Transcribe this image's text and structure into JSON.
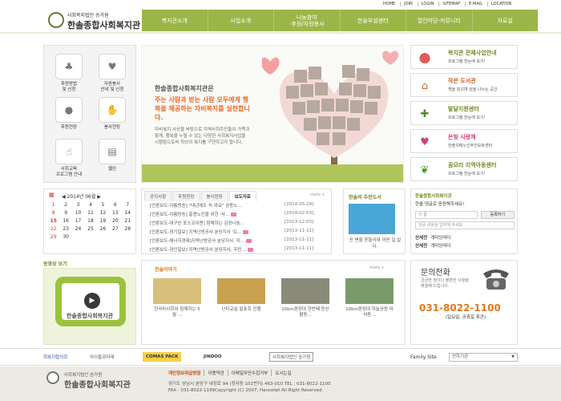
{
  "util_links": [
    "HOME",
    "JOIN",
    "LOGIN",
    "SITEMAP",
    "E-MAIL",
    "LOCATION"
  ],
  "logo": {
    "sub": "사회복지법인 승가원",
    "main": "한솔종합사회복지관"
  },
  "gnb": [
    {
      "label": "복지관소개"
    },
    {
      "label": "사업소개"
    },
    {
      "label": "나눔참여\n-후원/자원봉사"
    },
    {
      "label": "한솔부설센터"
    },
    {
      "label": "열린마당-커뮤니티"
    },
    {
      "label": "자료실"
    }
  ],
  "quick_menu": [
    {
      "label": "후원방법\n및 신청",
      "icon": "piggy-icon"
    },
    {
      "label": "자원봉사\n안내 및 신청",
      "icon": "heart-icon"
    },
    {
      "label": "후원현장",
      "icon": "gift-icon"
    },
    {
      "label": "봉사현장",
      "icon": "hands-icon"
    },
    {
      "label": "사회교육\n프로그램 안내",
      "icon": "pointer-icon"
    },
    {
      "label": "웹진",
      "icon": "book-icon"
    }
  ],
  "visual": {
    "title": "한솔종합사회복지관은",
    "slogan": "주는 사람과 받는 사람 모두에게 행복을 제공하는 자비복지를 실천합니다.",
    "desc": "자비복지 사상을 바탕으로 지역사회주민들이 가족과 함께, 행복을 누릴 수 있는 다양한 사회복지사업을 시행함으로써 최상의 복지를 구현하고자 합니다."
  },
  "right_banners": [
    {
      "title": "복지관 전체사업안내",
      "sub": "프로그램 한눈에 보기!",
      "icon": "balloon-icon"
    },
    {
      "title": "작은 도서관",
      "sub": "책을 읽으며 성을 나누는 공간.",
      "icon": "house-icon"
    },
    {
      "title": "발달지원센터",
      "sub": "프로그램 한눈에 보기!",
      "icon": "puzzle-icon"
    },
    {
      "title": "은빛 사랑채",
      "sub": "한솔치매노인주간보호센터",
      "icon": "heart-house-icon"
    },
    {
      "title": "꿈모리 지역아동센터",
      "sub": "프로그램 한눈에 보기!",
      "icon": "sprout-icon"
    }
  ],
  "calendar": {
    "month_label": "2014년 06월",
    "rows": [
      [
        "1",
        "2",
        "3",
        "4",
        "5",
        "6",
        "7"
      ],
      [
        "8",
        "9",
        "10",
        "11",
        "12",
        "13",
        "14"
      ],
      [
        "15",
        "16",
        "17",
        "18",
        "19",
        "20",
        "21"
      ],
      [
        "22",
        "23",
        "24",
        "25",
        "26",
        "27",
        "28"
      ],
      [
        "29",
        "30",
        "",
        "",
        "",
        "",
        ""
      ]
    ],
    "today": "15"
  },
  "board": {
    "tabs": [
      "공지사항",
      "후원현장",
      "봉사현장",
      "보도자료"
    ],
    "active_tab": 3,
    "more": "more +",
    "items": [
      {
        "title": "[언론보도-아름방송] \"내년에도 꼭 와요\" 공동노...",
        "date": "[2014-05-29]"
      },
      {
        "title": "[언론보도-아름방송] 홍콩노인을 위한 '사...",
        "date": "[2014-02-03]"
      },
      {
        "title": "[언론보도-대구신 포스코이엔] 함께하는 김장나눔...",
        "date": "[2013-12-03]"
      },
      {
        "title": "[언론보도-경기일보] 지역난방공사 분당지사 '오...",
        "date": "[2013-11-11]"
      },
      {
        "title": "[언론보도-에너지경제]지역난방공사 분당지사, 지...",
        "date": "[2013-11-11]"
      },
      {
        "title": "[언론보도-경인일보] 지역난방공사 분당지사, 주민...",
        "date": "[2013-11-11]"
      }
    ]
  },
  "book": {
    "title": "한솔의 추천도서",
    "caption": "진 변을 흔들리며 어떤 일 없다."
  },
  "comments": {
    "title": "한솔종합사회복지관",
    "subtitle": "한솔 댓글로 응원해주세요!",
    "name_placeholder": "이 름",
    "button": "등록하기",
    "input_placeholder": "댓글 내용을 입력해 주세요",
    "items": [
      {
        "name": "산세전",
        "text": "개미잉여다"
      },
      {
        "name": "산세전",
        "text": "개미잉여다"
      }
    ]
  },
  "video": {
    "title": "동영상 보기",
    "screen_text": "한솔종합사회복지관"
  },
  "stories": {
    "title": "한솔이야기",
    "more": "more +",
    "items": [
      {
        "caption": "한국마사회와 함께하는 5월 ..."
      },
      {
        "caption": "난타교실 발표회 진행"
      },
      {
        "caption": "10km원정대 한번째 등산활동..."
      },
      {
        "caption": "10km원정대 하늘공원 마라톤..."
      }
    ]
  },
  "phone": {
    "title": "문의전화",
    "desc": "궁금한 점이나 불편한 사항을 해결해 드립니다.",
    "number": "031-8022-1100",
    "hours": "(일요일, 공휴일 휴관)"
  },
  "family": {
    "logos": [
      "회복지협의회",
      "아이들과미래",
      "COMAS PACK",
      "JINDOO",
      "사회복지법인 승가원"
    ],
    "label": "Family Site",
    "select": "산하기관"
  },
  "footer": {
    "logo_sub": "사회복지법인 승가원",
    "logo_main": "한솔종합사회복지관",
    "links": [
      "개인정보취급방침",
      "이용약관",
      "이메일무단수집거부",
      "오시는길"
    ],
    "address": "경기도 성남시 분당구 내정로 94 (정자동 101번지) 463-010 TEL : 031-8022-1100",
    "copyright": "FAX : 031-8022-1199Copyright (C) 2007, Hansolwt All Right Reserved."
  },
  "colors": {
    "brand_green": "#9bb648",
    "accent_orange": "#e07a1a"
  }
}
